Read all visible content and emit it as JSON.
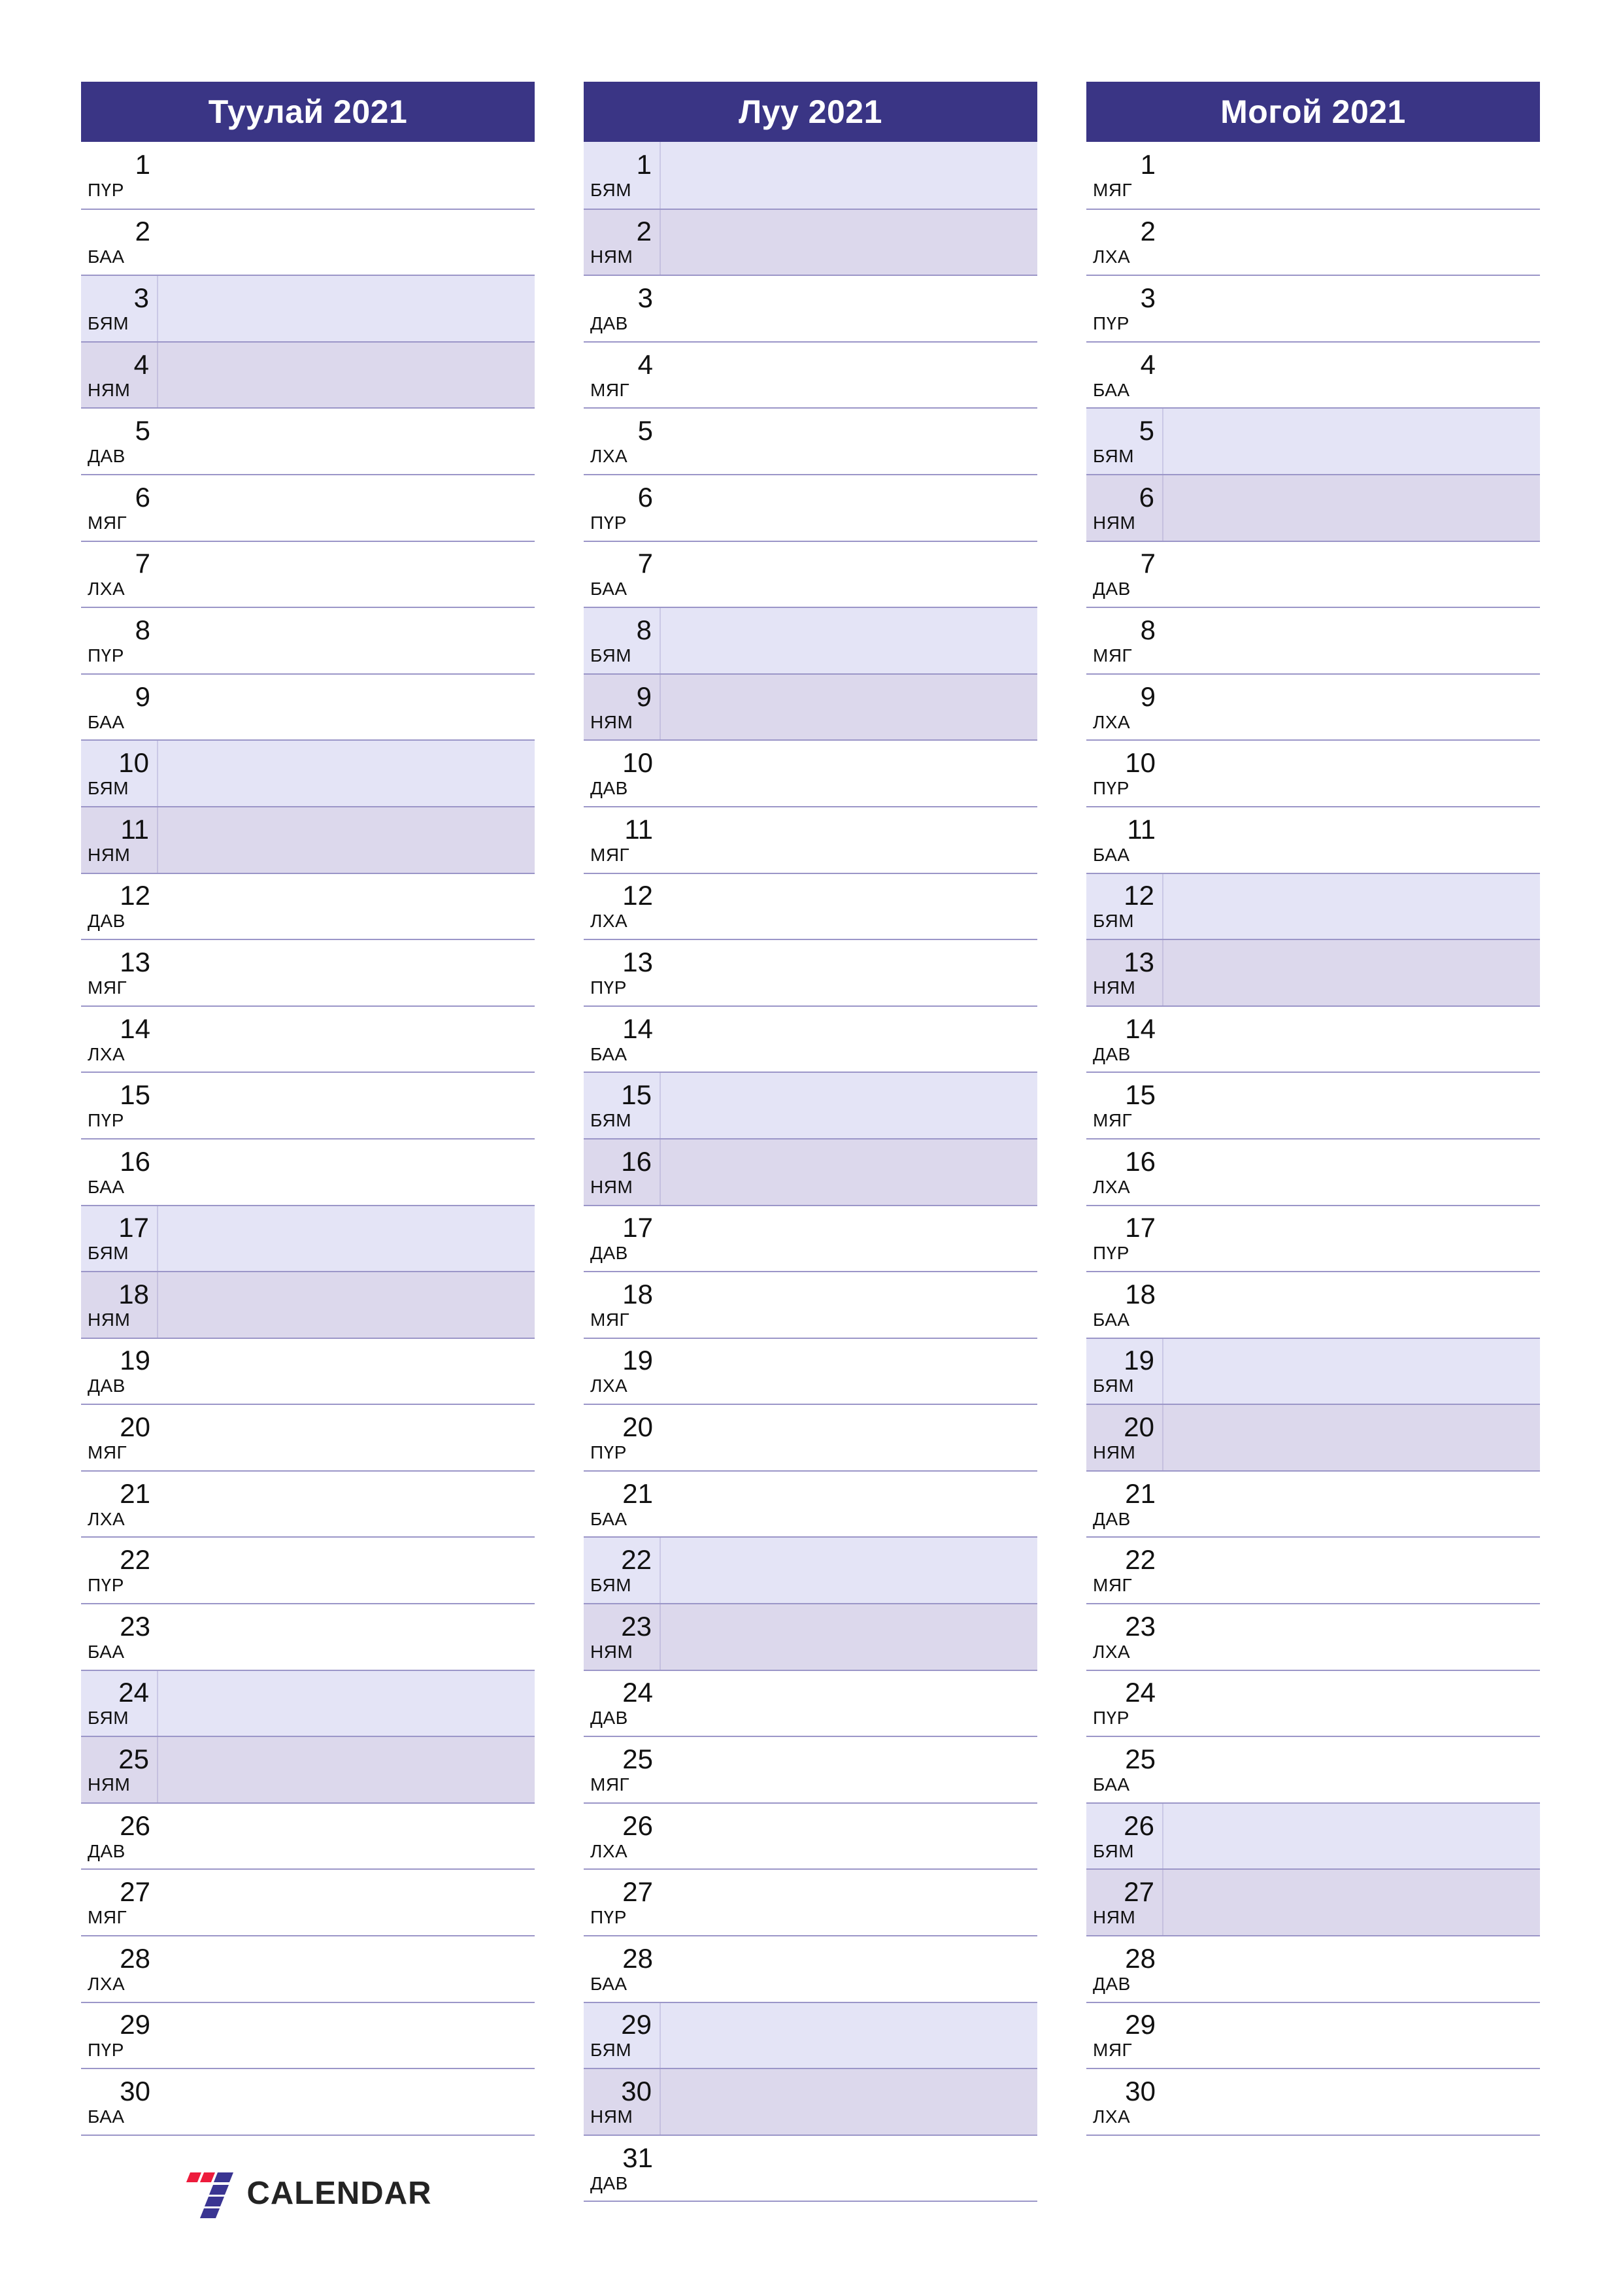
{
  "theme": {
    "header_bg": "#3a3585",
    "header_text": "#ffffff",
    "saturday_bg": "#e4e4f6",
    "sunday_bg": "#dcd8ec",
    "rule_color": "#9b96c8",
    "text_color": "#111111",
    "logo_red": "#ed1c3c",
    "logo_blue": "#3a3592",
    "logo_text_color": "#232323"
  },
  "weekday_codes": {
    "mon": "ДАВ",
    "tue": "МЯГ",
    "wed": "ЛХА",
    "thu": "ПҮР",
    "fri": "БАА",
    "sat": "БЯМ",
    "sun": "НЯМ"
  },
  "logo": {
    "mark_name": "seven-logo-mark",
    "text": "CALENDAR"
  },
  "columns": [
    {
      "title": "Туулай 2021",
      "days": [
        {
          "n": "1",
          "wd": "ПҮР",
          "t": ""
        },
        {
          "n": "2",
          "wd": "БАА",
          "t": ""
        },
        {
          "n": "3",
          "wd": "БЯМ",
          "t": "sat"
        },
        {
          "n": "4",
          "wd": "НЯМ",
          "t": "sun"
        },
        {
          "n": "5",
          "wd": "ДАВ",
          "t": ""
        },
        {
          "n": "6",
          "wd": "МЯГ",
          "t": ""
        },
        {
          "n": "7",
          "wd": "ЛХА",
          "t": ""
        },
        {
          "n": "8",
          "wd": "ПҮР",
          "t": ""
        },
        {
          "n": "9",
          "wd": "БАА",
          "t": ""
        },
        {
          "n": "10",
          "wd": "БЯМ",
          "t": "sat"
        },
        {
          "n": "11",
          "wd": "НЯМ",
          "t": "sun"
        },
        {
          "n": "12",
          "wd": "ДАВ",
          "t": ""
        },
        {
          "n": "13",
          "wd": "МЯГ",
          "t": ""
        },
        {
          "n": "14",
          "wd": "ЛХА",
          "t": ""
        },
        {
          "n": "15",
          "wd": "ПҮР",
          "t": ""
        },
        {
          "n": "16",
          "wd": "БАА",
          "t": ""
        },
        {
          "n": "17",
          "wd": "БЯМ",
          "t": "sat"
        },
        {
          "n": "18",
          "wd": "НЯМ",
          "t": "sun"
        },
        {
          "n": "19",
          "wd": "ДАВ",
          "t": ""
        },
        {
          "n": "20",
          "wd": "МЯГ",
          "t": ""
        },
        {
          "n": "21",
          "wd": "ЛХА",
          "t": ""
        },
        {
          "n": "22",
          "wd": "ПҮР",
          "t": ""
        },
        {
          "n": "23",
          "wd": "БАА",
          "t": ""
        },
        {
          "n": "24",
          "wd": "БЯМ",
          "t": "sat"
        },
        {
          "n": "25",
          "wd": "НЯМ",
          "t": "sun"
        },
        {
          "n": "26",
          "wd": "ДАВ",
          "t": ""
        },
        {
          "n": "27",
          "wd": "МЯГ",
          "t": ""
        },
        {
          "n": "28",
          "wd": "ЛХА",
          "t": ""
        },
        {
          "n": "29",
          "wd": "ПҮР",
          "t": ""
        },
        {
          "n": "30",
          "wd": "БАА",
          "t": ""
        }
      ]
    },
    {
      "title": "Луу 2021",
      "days": [
        {
          "n": "1",
          "wd": "БЯМ",
          "t": "sat"
        },
        {
          "n": "2",
          "wd": "НЯМ",
          "t": "sun"
        },
        {
          "n": "3",
          "wd": "ДАВ",
          "t": ""
        },
        {
          "n": "4",
          "wd": "МЯГ",
          "t": ""
        },
        {
          "n": "5",
          "wd": "ЛХА",
          "t": ""
        },
        {
          "n": "6",
          "wd": "ПҮР",
          "t": ""
        },
        {
          "n": "7",
          "wd": "БАА",
          "t": ""
        },
        {
          "n": "8",
          "wd": "БЯМ",
          "t": "sat"
        },
        {
          "n": "9",
          "wd": "НЯМ",
          "t": "sun"
        },
        {
          "n": "10",
          "wd": "ДАВ",
          "t": ""
        },
        {
          "n": "11",
          "wd": "МЯГ",
          "t": ""
        },
        {
          "n": "12",
          "wd": "ЛХА",
          "t": ""
        },
        {
          "n": "13",
          "wd": "ПҮР",
          "t": ""
        },
        {
          "n": "14",
          "wd": "БАА",
          "t": ""
        },
        {
          "n": "15",
          "wd": "БЯМ",
          "t": "sat"
        },
        {
          "n": "16",
          "wd": "НЯМ",
          "t": "sun"
        },
        {
          "n": "17",
          "wd": "ДАВ",
          "t": ""
        },
        {
          "n": "18",
          "wd": "МЯГ",
          "t": ""
        },
        {
          "n": "19",
          "wd": "ЛХА",
          "t": ""
        },
        {
          "n": "20",
          "wd": "ПҮР",
          "t": ""
        },
        {
          "n": "21",
          "wd": "БАА",
          "t": ""
        },
        {
          "n": "22",
          "wd": "БЯМ",
          "t": "sat"
        },
        {
          "n": "23",
          "wd": "НЯМ",
          "t": "sun"
        },
        {
          "n": "24",
          "wd": "ДАВ",
          "t": ""
        },
        {
          "n": "25",
          "wd": "МЯГ",
          "t": ""
        },
        {
          "n": "26",
          "wd": "ЛХА",
          "t": ""
        },
        {
          "n": "27",
          "wd": "ПҮР",
          "t": ""
        },
        {
          "n": "28",
          "wd": "БАА",
          "t": ""
        },
        {
          "n": "29",
          "wd": "БЯМ",
          "t": "sat"
        },
        {
          "n": "30",
          "wd": "НЯМ",
          "t": "sun"
        },
        {
          "n": "31",
          "wd": "ДАВ",
          "t": ""
        }
      ]
    },
    {
      "title": "Могой 2021",
      "days": [
        {
          "n": "1",
          "wd": "МЯГ",
          "t": ""
        },
        {
          "n": "2",
          "wd": "ЛХА",
          "t": ""
        },
        {
          "n": "3",
          "wd": "ПҮР",
          "t": ""
        },
        {
          "n": "4",
          "wd": "БАА",
          "t": ""
        },
        {
          "n": "5",
          "wd": "БЯМ",
          "t": "sat"
        },
        {
          "n": "6",
          "wd": "НЯМ",
          "t": "sun"
        },
        {
          "n": "7",
          "wd": "ДАВ",
          "t": ""
        },
        {
          "n": "8",
          "wd": "МЯГ",
          "t": ""
        },
        {
          "n": "9",
          "wd": "ЛХА",
          "t": ""
        },
        {
          "n": "10",
          "wd": "ПҮР",
          "t": ""
        },
        {
          "n": "11",
          "wd": "БАА",
          "t": ""
        },
        {
          "n": "12",
          "wd": "БЯМ",
          "t": "sat"
        },
        {
          "n": "13",
          "wd": "НЯМ",
          "t": "sun"
        },
        {
          "n": "14",
          "wd": "ДАВ",
          "t": ""
        },
        {
          "n": "15",
          "wd": "МЯГ",
          "t": ""
        },
        {
          "n": "16",
          "wd": "ЛХА",
          "t": ""
        },
        {
          "n": "17",
          "wd": "ПҮР",
          "t": ""
        },
        {
          "n": "18",
          "wd": "БАА",
          "t": ""
        },
        {
          "n": "19",
          "wd": "БЯМ",
          "t": "sat"
        },
        {
          "n": "20",
          "wd": "НЯМ",
          "t": "sun"
        },
        {
          "n": "21",
          "wd": "ДАВ",
          "t": ""
        },
        {
          "n": "22",
          "wd": "МЯГ",
          "t": ""
        },
        {
          "n": "23",
          "wd": "ЛХА",
          "t": ""
        },
        {
          "n": "24",
          "wd": "ПҮР",
          "t": ""
        },
        {
          "n": "25",
          "wd": "БАА",
          "t": ""
        },
        {
          "n": "26",
          "wd": "БЯМ",
          "t": "sat"
        },
        {
          "n": "27",
          "wd": "НЯМ",
          "t": "sun"
        },
        {
          "n": "28",
          "wd": "ДАВ",
          "t": ""
        },
        {
          "n": "29",
          "wd": "МЯГ",
          "t": ""
        },
        {
          "n": "30",
          "wd": "ЛХА",
          "t": ""
        }
      ]
    }
  ]
}
